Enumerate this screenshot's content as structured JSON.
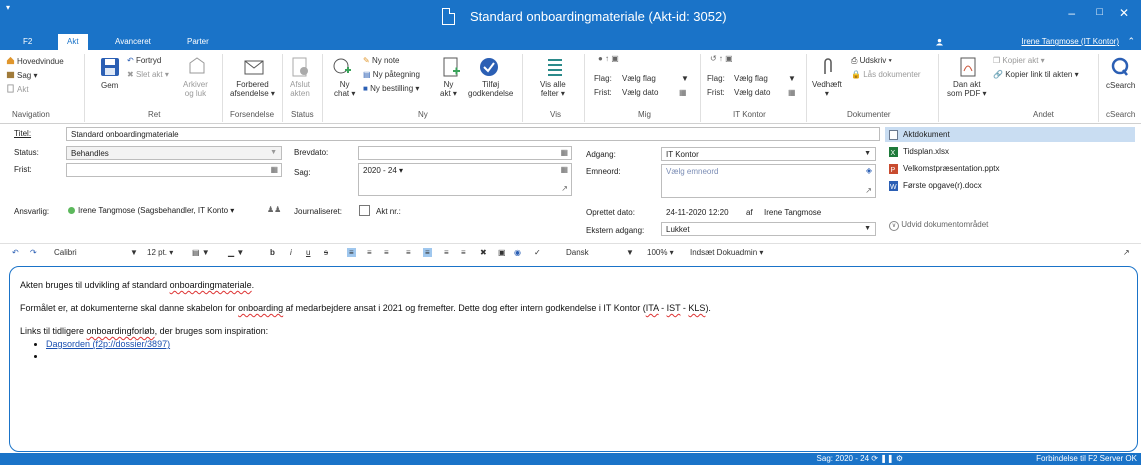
{
  "window": {
    "title": "Standard onboardingmateriale (Akt-id: 3052)",
    "sys_menu": "▾",
    "minimize": "–",
    "maximize": "□",
    "close": "✕"
  },
  "tabs": [
    {
      "label": "F2"
    },
    {
      "label": "Akt"
    },
    {
      "label": "Avanceret"
    },
    {
      "label": "Parter"
    }
  ],
  "user": "Irene Tangmose (IT Kontor)",
  "collapse_ribbon": "⌃",
  "ribbon": {
    "navigation": {
      "hovedvindue": "Hovedvindue",
      "sag": "Sag ▾",
      "akt": "Akt",
      "label": "Navigation"
    },
    "ret": {
      "gem": "Gem",
      "fortryd": "Fortryd",
      "slet_akt": "Slet akt ▾",
      "arkiver": "Arkiver",
      "og_luk": "og luk",
      "label": "Ret"
    },
    "forsendelse": {
      "forbered": "Forbered",
      "afsendelse": "afsendelse ▾",
      "label": "Forsendelse"
    },
    "status": {
      "afslut": "Afslut",
      "akten": "akten",
      "label": "Status"
    },
    "ny": {
      "ny_chat_1": "Ny",
      "ny_chat_2": "chat ▾",
      "ny_note": "Ny note",
      "ny_paategning": "Ny påtegning",
      "ny_bestilling": "Ny bestilling ▾",
      "ny_akt_1": "Ny",
      "ny_akt_2": "akt ▾",
      "tilfoej_1": "Tilføj",
      "tilfoej_2": "godkendelse",
      "label": "Ny"
    },
    "vis": {
      "vis_alle_1": "Vis alle",
      "vis_alle_2": "felter ▾",
      "label": "Vis"
    },
    "mig": {
      "flag_label": "Flag:",
      "flag_value": "Vælg flag",
      "frist_label": "Frist:",
      "frist_value": "Vælg dato",
      "label": "Mig"
    },
    "it_kontor": {
      "flag_label": "Flag:",
      "flag_value": "Vælg flag",
      "frist_label": "Frist:",
      "frist_value": "Vælg dato",
      "label": "IT Kontor"
    },
    "dokumenter": {
      "vedhaeft": "Vedhæft",
      "vedhaeft_caret": "▾",
      "udskriv": "Udskriv ▾",
      "laas": "Lås dokumenter",
      "label": "Dokumenter"
    },
    "andet": {
      "dan_akt_1": "Dan akt",
      "dan_akt_2": "som PDF ▾",
      "kopier_akt": "Kopier akt ▾",
      "kopier_link": "Kopier link til akten ▾",
      "label": "Andet"
    },
    "csearch": {
      "button": "cSearch",
      "label": "cSearch"
    }
  },
  "form": {
    "titel_label": "Titel:",
    "titel_value": "Standard onboardingmateriale",
    "status_label": "Status:",
    "status_value": "Behandles",
    "frist_label": "Frist:",
    "frist_value": "",
    "ansvarlig_label": "Ansvarlig:",
    "ansvarlig_value": "Irene Tangmose (Sagsbehandler, IT Konto ▾",
    "brevdato_label": "Brevdato:",
    "brevdato_value": "",
    "sag_label": "Sag:",
    "sag_value": "2020 - 24 ▾",
    "journaliseret_label": "Journaliseret:",
    "akt_nr_label": "Akt nr.:",
    "adgang_label": "Adgang:",
    "adgang_value": "IT Kontor",
    "emneord_label": "Emneord:",
    "emneord_placeholder": "Vælg emneord",
    "oprettet_label": "Oprettet dato:",
    "oprettet_value": "24-11-2020 12:20",
    "oprettet_af": "af",
    "oprettet_by": "Irene Tangmose",
    "ekstern_label": "Ekstern adgang:",
    "ekstern_value": "Lukket"
  },
  "documents": {
    "items": [
      {
        "name": "Aktdokument",
        "icon": "document-icon",
        "color": "#6b7a8f"
      },
      {
        "name": "Tidsplan.xlsx",
        "icon": "excel-icon",
        "color": "#1e7a3a"
      },
      {
        "name": "Velkomstpræsentation.pptx",
        "icon": "powerpoint-icon",
        "color": "#c84b2f"
      },
      {
        "name": "Første opgave(r).docx",
        "icon": "word-icon",
        "color": "#2b5fb4"
      }
    ],
    "expand_label": "Udvid dokumentområdet"
  },
  "editor_toolbar": {
    "font": "Calibri",
    "size": "12 pt. ▾",
    "language": "Dansk",
    "zoom": "100% ▾",
    "insert": "Indsæt Dokuadmin ▾"
  },
  "editor": {
    "p1_a": "Akten bruges til udvikling af standard ",
    "p1_b": "onboardingmateriale",
    "p1_c": ".",
    "p2_a": "Formålet er, at dokumenterne skal danne skabelon for ",
    "p2_b": "onboarding",
    "p2_c": " af medarbejdere ansat i 2021 og fremefter. Dette dog efter intern godkendelse i IT Kontor (",
    "p2_d": "ITA",
    "p2_e": " - ",
    "p2_f": "IST",
    "p2_g": " - ",
    "p2_h": "KLS",
    "p2_i": ").",
    "p3_a": "Links til tidligere ",
    "p3_b": "onboardingforløb",
    "p3_c": ", der bruges som inspiration:",
    "link1": "Dagsorden (f2p://dossier/3897)"
  },
  "statusbar": {
    "sag": "Sag: 2020 - 24",
    "connection": "Forbindelse til F2 Server OK"
  },
  "colors": {
    "accent": "#1a73c8",
    "selected": "#c9ddf2"
  }
}
